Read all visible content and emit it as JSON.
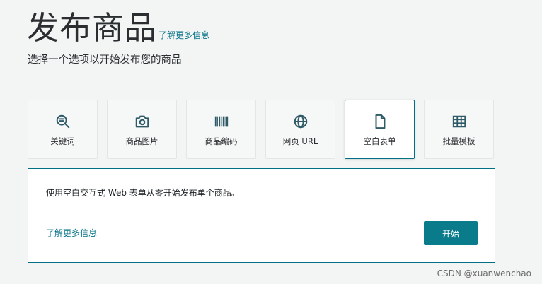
{
  "header": {
    "title": "发布商品",
    "learn_more": "了解更多信息",
    "subtitle": "选择一个选项以开始发布您的商品"
  },
  "options": [
    {
      "label": "关键词",
      "icon": "search-list-icon",
      "selected": false
    },
    {
      "label": "商品图片",
      "icon": "camera-icon",
      "selected": false
    },
    {
      "label": "商品编码",
      "icon": "barcode-icon",
      "selected": false
    },
    {
      "label": "网页 URL",
      "icon": "globe-icon",
      "selected": false
    },
    {
      "label": "空白表单",
      "icon": "blank-document-icon",
      "selected": true
    },
    {
      "label": "批量模板",
      "icon": "spreadsheet-grid-icon",
      "selected": false
    }
  ],
  "panel": {
    "description": "使用空白交互式 Web 表单从零开始发布单个商品。",
    "learn_more": "了解更多信息",
    "start_label": "开始"
  },
  "watermark": "CSDN @xuanwenchao",
  "colors": {
    "accent": "#007185",
    "button": "#0a7b8a",
    "background": "#f3f4f4",
    "icon": "#2f5a68"
  }
}
